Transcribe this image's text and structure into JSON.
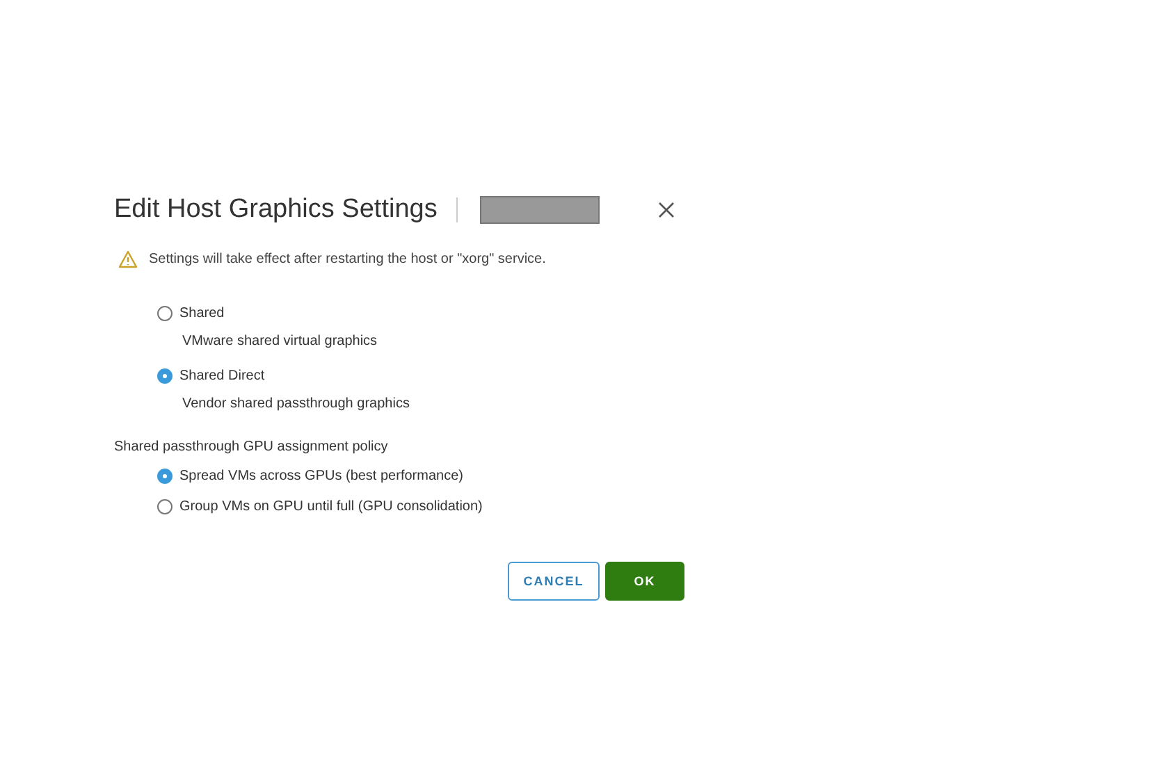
{
  "dialog": {
    "title": "Edit Host Graphics Settings",
    "warning": "Settings will take effect after restarting the host or \"xorg\" service.",
    "graphics_types": [
      {
        "label": "Shared",
        "description": "VMware shared virtual graphics",
        "selected": false
      },
      {
        "label": "Shared Direct",
        "description": "Vendor shared passthrough graphics",
        "selected": true
      }
    ],
    "policy_heading": "Shared passthrough GPU assignment policy",
    "policies": [
      {
        "label": "Spread VMs across GPUs (best performance)",
        "selected": true
      },
      {
        "label": "Group VMs on GPU until full (GPU consolidation)",
        "selected": false
      }
    ],
    "buttons": [
      {
        "label": "CANCEL",
        "kind": "secondary"
      },
      {
        "label": "OK",
        "kind": "primary"
      }
    ]
  }
}
